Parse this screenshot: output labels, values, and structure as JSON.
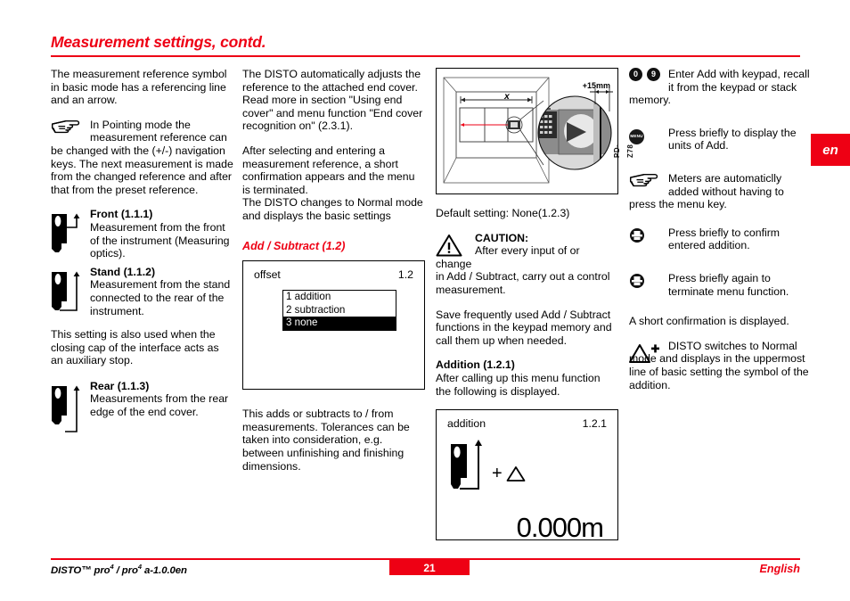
{
  "header": {
    "title": "Measurement settings, contd.",
    "accent_color": "#ee0014"
  },
  "language_tab": {
    "label": "en"
  },
  "column1": {
    "intro": "The measurement reference symbol in basic mode has a referencing line and an arrow.",
    "hint_pointing": {
      "icon": "pointing-hand-icon",
      "line1": "In Pointing mode the",
      "line2": "measurement reference can",
      "rest": "be changed with the (+/-) navigation keys. The next measurement is made from the changed reference and after that from the preset reference."
    },
    "refs": [
      {
        "icon": "device-front-reference-icon",
        "title": "Front (1.1.1)",
        "text": "Measurement from the front of the instrument (Measuring optics)."
      },
      {
        "icon": "device-stand-reference-icon",
        "title": "Stand (1.1.2)",
        "text": "Measurement from the stand connected to the rear of the instrument."
      },
      {
        "icon": "device-rear-reference-icon",
        "title": "Rear (1.1.3)",
        "text": "Measurements from the rear edge of the end cover."
      }
    ],
    "note_between": "This setting is also used when the closing cap of the interface acts as an auxiliary stop."
  },
  "column2": {
    "para1": "The DISTO automatically adjusts the reference to the attached end cover. Read more in section \"Using end cover\" and menu function \"End cover recognition on\" (2.3.1).",
    "para2": "After selecting and entering a measurement reference, a short confirmation appears and the menu is terminated.",
    "para3": "The DISTO changes to Normal mode and displays the basic settings",
    "section_heading": "Add / Subtract (1.2)",
    "lcd_offset": {
      "title": "offset",
      "code": "1.2",
      "options": [
        {
          "label": "1 addition",
          "selected": false
        },
        {
          "label": "2 subtraction",
          "selected": false
        },
        {
          "label": "3 none",
          "selected": true
        }
      ]
    },
    "para4": "This adds or subtracts to / from measurements. Tolerances can be taken into consideration, e.g. between unfinishing and finishing dimensions."
  },
  "column3": {
    "illustration": {
      "name": "room-measurement-diagram",
      "dimension_label": "x",
      "offset_label": "+15mm",
      "image_code": "PD-Z78"
    },
    "default_setting": "Default setting: None(1.2.3)",
    "caution": {
      "icon": "warning-triangle-icon",
      "title": "CAUTION:",
      "line1": "After every input of or change",
      "rest": "in Add / Subtract, carry out a control measurement."
    },
    "para1": "Save frequently used Add / Subtract functions in the keypad memory and call them up when needed.",
    "heading_addition": "Addition (1.2.1)",
    "para2": "After calling up this menu function the following is displayed.",
    "lcd_addition": {
      "title": "addition",
      "code": "1.2.1",
      "symbol": "+",
      "value": "0.000m",
      "device_icon": "device-stand-reference-icon",
      "triangle_icon": "delta-triangle-icon"
    }
  },
  "column4": {
    "items": [
      {
        "icon": "keypad-digit-keys-icon",
        "keys": [
          "0",
          "9"
        ],
        "line1": "Enter Add with keypad, recall",
        "rest": "it from the keypad or stack memory."
      },
      {
        "icon": "menu-key-icon",
        "key_label": "MENU",
        "line1": "Press briefly to display the",
        "rest": "units of Add."
      },
      {
        "icon": "pointing-hand-icon",
        "line1": "Meters are automaticlly",
        "line2": "added without having to",
        "rest": "press the menu key."
      },
      {
        "icon": "confirm-key-icon",
        "line1": "Press briefly to confirm",
        "rest": "entered addition."
      },
      {
        "icon": "confirm-key-icon",
        "line1": "Press briefly again to",
        "rest": "terminate menu function."
      }
    ],
    "confirmation_note": "A short confirmation is displayed.",
    "final": {
      "icon": "delta-plus-icon",
      "text": "DISTO switches to Normal mode and displays in the uppermost line of basic setting the symbol of the addition."
    }
  },
  "footer": {
    "left_main": "DISTO™ pro",
    "left_sup1": "4",
    "left_mid": " / pro",
    "left_sup2": "4",
    "left_end": " a-1.0.0en",
    "page_number": "21",
    "language": "English"
  }
}
